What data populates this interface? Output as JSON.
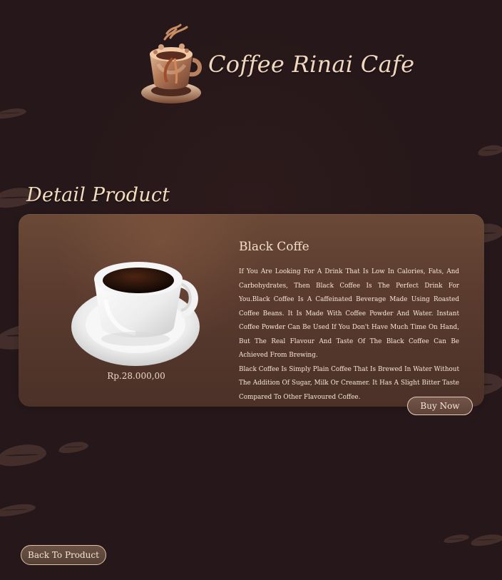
{
  "brand": {
    "name": "Coffee Rinai Cafe",
    "logo_icon": "coffee-cup-logo-icon"
  },
  "page": {
    "section_title": "Detail Product"
  },
  "product": {
    "name": "Black Coffe",
    "price": "Rp.28.000,00",
    "image_icon": "coffee-cup-image",
    "description_1": "If You Are Looking For A Drink That Is Low In Calories, Fats, And Carbohydrates, Then Black Coffee Is The Perfect Drink For You.Black Coffee Is A Caffeinated Beverage Made Using Roasted Coffee Beans. It Is Made With Coffee Powder And Water. Instant Coffee Powder Can Be Used If You Don't Have Much Time On Hand, But The Real Flavour And Taste Of The Black Coffee Can Be Achieved From Brewing.",
    "description_2": "Black Coffee Is Simply Plain Coffee That Is Brewed In Water Without The Addition Of Sugar, Milk Or Creamer. It Has A Slight Bitter Taste Compared To Other Flavoured Coffee."
  },
  "actions": {
    "buy_now": "Buy Now",
    "back_to_product": "Back To Product"
  },
  "colors": {
    "background": "#25171a",
    "card": "#5b3c2f",
    "accent": "#f0d7bf"
  }
}
